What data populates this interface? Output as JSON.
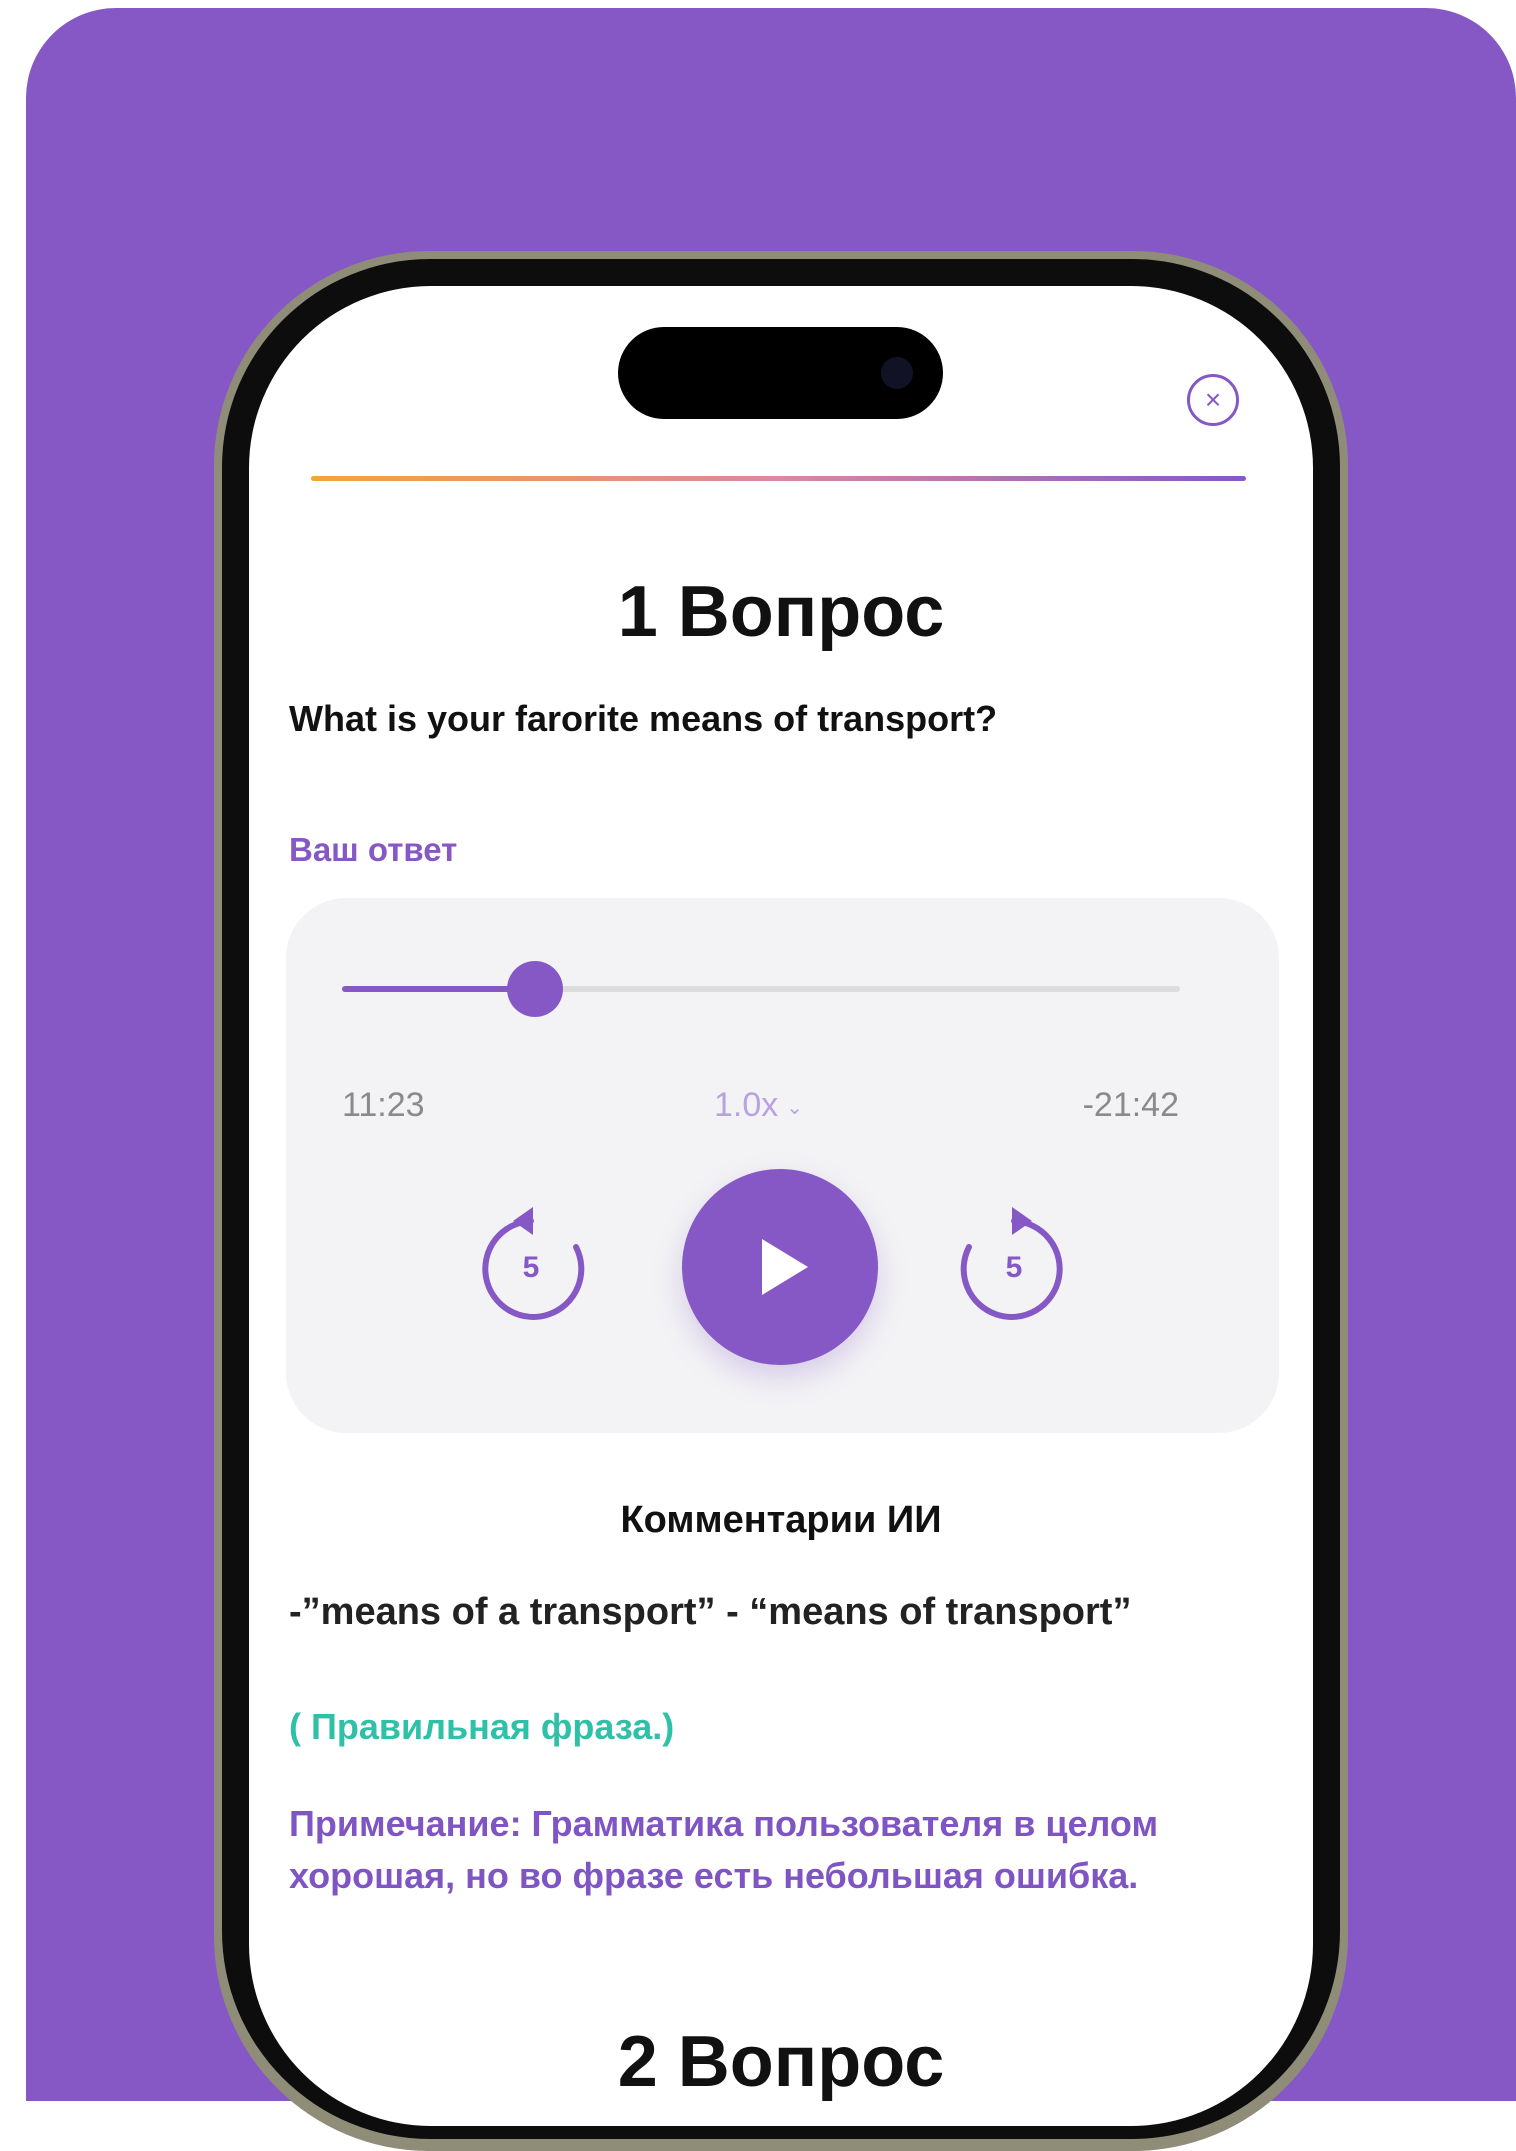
{
  "colors": {
    "accent": "#8558c6",
    "correct": "#2fc0a8",
    "progress_start": "#f3a43a",
    "progress_end": "#8558c6"
  },
  "screen": {
    "close_icon": "close-icon",
    "question1": {
      "title": "1 Вопрос",
      "text": "What is your farorite means of transport?"
    },
    "answer_label": "Ваш ответ",
    "player": {
      "elapsed": "11:23",
      "remaining": "-21:42",
      "speed": "1.0x",
      "progress": 0.23,
      "skip_back_seconds": "5",
      "skip_forward_seconds": "5",
      "play_icon": "play-icon"
    },
    "ai_comments": {
      "title": "Комментарии ИИ",
      "correction": "-”means of a transport” - “means of transport”",
      "correct_phrase": "( Правильная фраза.)",
      "note": "Примечание: Грамматика пользователя в целом хорошая, но во фразе есть небольшая ошибка."
    },
    "question2": {
      "title": "2 Вопрос"
    }
  }
}
